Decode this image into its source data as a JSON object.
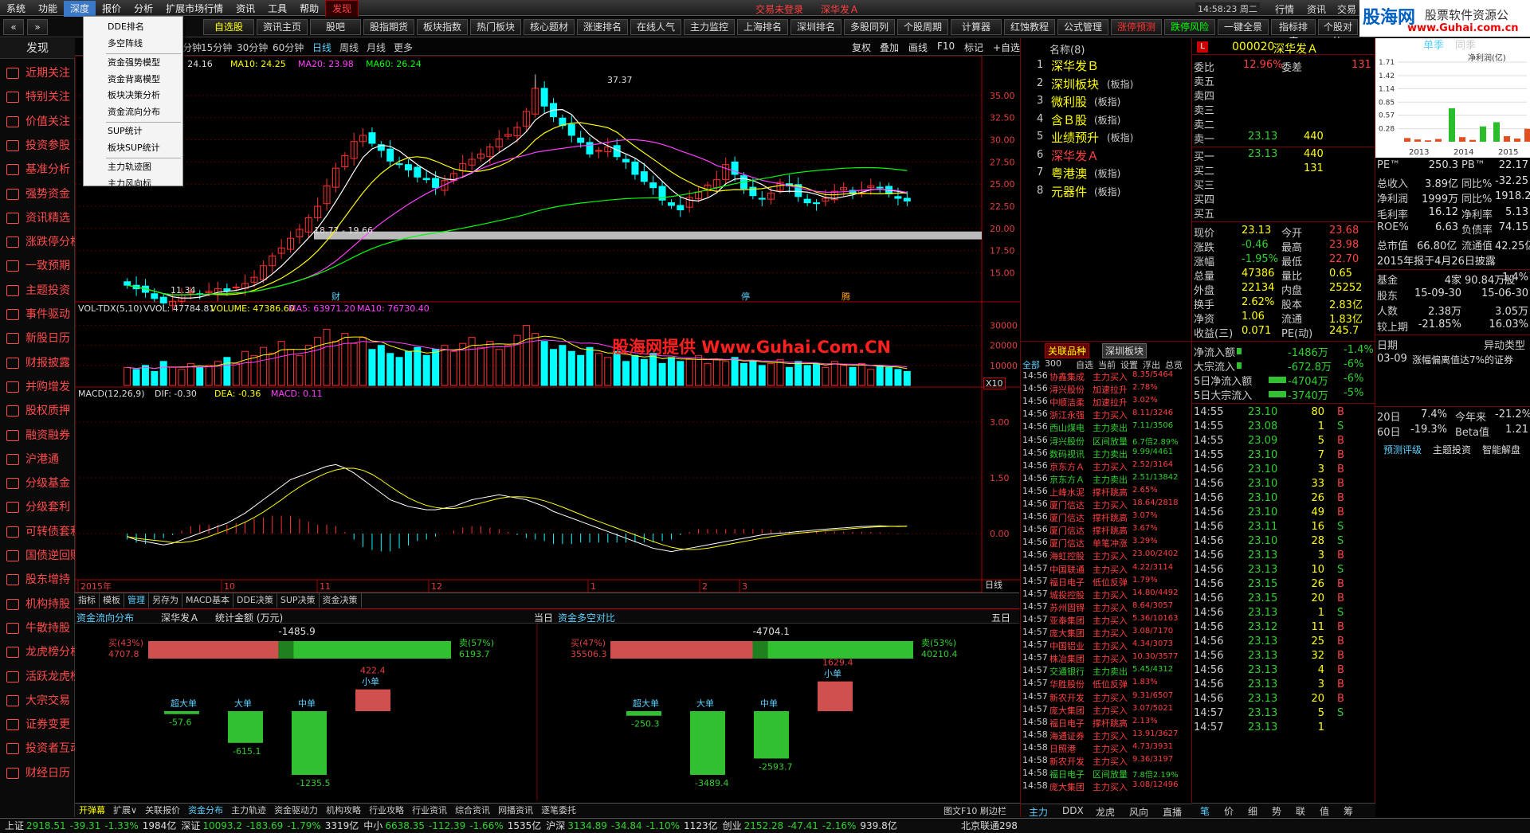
{
  "menu": [
    "系统",
    "功能",
    "深度",
    "报价",
    "分析",
    "扩展市场行情",
    "资讯",
    "工具",
    "帮助",
    "发现"
  ],
  "menu_center": {
    "notice": "交易未登录",
    "stock": "深华发Ａ",
    "time": "14:58:23 周二",
    "right": [
      "行情",
      "资讯",
      "交易"
    ]
  },
  "brand": {
    "name": "股海网",
    "sub": "股票软件资源公",
    "url": "www.Guhai.com.cn"
  },
  "toolbar": [
    "自选股",
    "资讯主页",
    "股吧",
    "股指期货",
    "板块指数",
    "热门板块",
    "核心题材",
    "涨速排名",
    "在线人气",
    "主力监控",
    "上海排名",
    "深圳排名",
    "多股同列",
    "个股周期",
    "计算器",
    "红蚀教程",
    "公式管理",
    "涨停预测",
    "跌停风险",
    "一键全景",
    "指标排序",
    "个股对比"
  ],
  "sidebar": [
    "发现",
    "近期关注",
    "特别关注",
    "价值关注",
    "投资参股",
    "基准分析",
    "强势资金",
    "资讯精选",
    "涨跌停分析",
    "一致预期",
    "主题投资",
    "事件驱动",
    "新股日历",
    "财报披露",
    "并购增发",
    "股权质押",
    "融资融券",
    "沪港通",
    "分级基金",
    "分级套利",
    "可转债套利",
    "国债逆回购",
    "股东增持",
    "机构持股",
    "牛散持股",
    "龙虎榜分析",
    "活跃龙虎榜",
    "大宗交易",
    "证券变更",
    "投资者互动",
    "财经日历"
  ],
  "dropdown": [
    [
      "DDE排名",
      "多空阵线"
    ],
    [
      "资金强势模型",
      "资金背离模型",
      "板块决策分析",
      "资金流向分布"
    ],
    [
      "SUP统计",
      "板块SUP统计"
    ],
    [
      "主力轨迹图",
      "主力风向标"
    ]
  ],
  "period_tabs": [
    "分钟",
    "15分钟",
    "30分钟",
    "60分钟",
    "日线",
    "周线",
    "月线",
    "更多"
  ],
  "chart_tools": [
    "复权",
    "叠加",
    "画线",
    "F10",
    "标记",
    "+自选"
  ],
  "ma_legend": {
    "ma5": "MA5: 24.16",
    "ma10": "MA10: 24.25",
    "ma20": "MA20: 23.98",
    "ma60": "MA60: 26.24"
  },
  "vol_legend": {
    "name": "VOL-TDX(5,10)",
    "vvol": "VVOL: 47784.81",
    "volume": "VOLUME: 47386.60",
    "ma5": "MA5: 63971.20",
    "ma10": "MA10: 76730.40"
  },
  "macd_legend": {
    "name": "MACD(12,26,9)",
    "dif": "DIF: -0.30",
    "dea": "DEA: -0.36",
    "macd": "MACD: 0.11"
  },
  "price_axis": [
    "35.00",
    "32.50",
    "30.00",
    "27.50",
    "25.00",
    "22.50",
    "20.00",
    "17.50",
    "15.00"
  ],
  "vol_axis": [
    "30000",
    "20000",
    "10000"
  ],
  "macd_axis": [
    "3.00",
    "1.50",
    "0.00"
  ],
  "x_axis": [
    "2015年",
    "10",
    "11",
    "12",
    "1",
    "2",
    "3"
  ],
  "chart_labels": {
    "high": "37.37",
    "low": "11.34",
    "band": "18.77 - 19.66",
    "unit": "X10",
    "period": "日线",
    "watermark": "股海网提供 Www.Guhai.Com.CN",
    "events": [
      "财",
      "停",
      "腾"
    ]
  },
  "chart_data": [
    {
      "type": "candlestick",
      "title": "深华发Ａ 日线",
      "yrange": [
        12,
        37.5
      ],
      "events_shown": [
        "high 37.37",
        "low 11.34"
      ],
      "closes": [
        13.6,
        13.2,
        12.8,
        12.1,
        11.6,
        11.8,
        12.5,
        12.8,
        12.6,
        12.9,
        13.2,
        13.0,
        13.4,
        13.8,
        14.5,
        15.8,
        16.9,
        17.8,
        18.9,
        19.9,
        21.2,
        22.5,
        24.8,
        26.8,
        28.2,
        29.8,
        30.5,
        29.6,
        28.8,
        27.6,
        27.2,
        26.6,
        25.8,
        25.5,
        24.6,
        25.4,
        26.2,
        27.3,
        27.8,
        28.4,
        29.2,
        30.1,
        30.6,
        31.4,
        33.2,
        35.8,
        33.8,
        32.6,
        31.6,
        30.5,
        29.7,
        28.4,
        28.8,
        29.2,
        28.1,
        27.5,
        26.1,
        25.3,
        24.6,
        23.2,
        22.6,
        22.1,
        23.5,
        24.1,
        24.9,
        25.5,
        27.2,
        26.1,
        24.5,
        23.7,
        23.3,
        24.0,
        25.2,
        24.8,
        23.6,
        22.9,
        22.8,
        23.4,
        24.2,
        24.6,
        23.9,
        24.3,
        24.8,
        24.6,
        23.9,
        23.4,
        23.1
      ]
    },
    {
      "type": "bar",
      "title": "VOL-TDX(5,10)",
      "yrange": [
        0,
        35000
      ],
      "values": [
        9000,
        8000,
        10000,
        7000,
        12000,
        9000,
        8000,
        11000,
        9000,
        10000,
        12000,
        14000,
        11000,
        17000,
        15000,
        19000,
        16000,
        22000,
        18000,
        15000,
        20000,
        24000,
        28000,
        22000,
        26000,
        21000,
        24000,
        18000,
        20000,
        16000,
        14000,
        17000,
        19000,
        15000,
        18000,
        20000,
        17000,
        21000,
        24000,
        19000,
        22000,
        18000,
        20000,
        25000,
        30000,
        26000,
        22000,
        18000,
        20000,
        17000,
        15000,
        19000,
        16000,
        14000,
        17000,
        12000,
        15000,
        13000,
        16000,
        11000,
        14000,
        12000,
        13000,
        15000,
        11000,
        13000,
        12000,
        14000,
        11000,
        12000,
        10000,
        11000,
        13000,
        9000,
        12000,
        10000,
        11000,
        9000,
        12000,
        10000,
        9000,
        11000,
        8000,
        10000,
        9000,
        8000,
        7000
      ]
    },
    {
      "type": "bar",
      "title": "MACD(12,26,9)",
      "yrange": [
        -1.2,
        3.6
      ],
      "values": [
        -0.2,
        -0.3,
        -0.35,
        -0.4,
        -0.45,
        -0.4,
        -0.3,
        -0.2,
        -0.1,
        0,
        0.1,
        0.2,
        0.35,
        0.5,
        0.7,
        0.9,
        1.1,
        1.3,
        1.5,
        1.6,
        1.7,
        1.8,
        1.9,
        1.95,
        1.85,
        1.7,
        1.5,
        1.3,
        1.1,
        0.9,
        0.8,
        0.7,
        0.65,
        0.6,
        0.6,
        0.65,
        0.7,
        0.8,
        0.9,
        0.95,
        1.0,
        1.05,
        1.0,
        0.95,
        0.9,
        0.8,
        0.7,
        0.55,
        0.45,
        0.35,
        0.25,
        0.15,
        0.05,
        -0.05,
        -0.15,
        -0.25,
        -0.35,
        -0.45,
        -0.55,
        -0.6,
        -0.65,
        -0.6,
        -0.55,
        -0.5,
        -0.45,
        -0.4,
        -0.35,
        -0.3,
        -0.25,
        -0.2,
        -0.15,
        -0.12,
        -0.1,
        -0.08,
        -0.05,
        -0.03,
        0,
        0.02,
        0.04,
        0.06,
        0.08,
        0.1,
        0.11,
        0.12,
        0.11,
        0.1,
        0.11
      ]
    }
  ],
  "flow": {
    "title": "资金流向分布",
    "stock": "深华发Ａ",
    "unit": "统计金额 (万元)",
    "left": {
      "period": "当日",
      "net": "-1485.9",
      "buy_pct": "买(43%)",
      "buy": "4707.8",
      "sell_pct": "卖(57%)",
      "sell": "6193.7",
      "buy_share": 0.43,
      "cats": [
        {
          "name": "超大单",
          "value": "-57.6"
        },
        {
          "name": "大单",
          "value": "-615.1"
        },
        {
          "name": "中单",
          "value": "-1235.5"
        },
        {
          "name": "小单",
          "value": "422.4"
        }
      ]
    },
    "right_title": "资金多空对比",
    "right": {
      "period": "五日",
      "net": "-4704.1",
      "buy_pct": "买(47%)",
      "buy": "35506.3",
      "sell_pct": "卖(53%)",
      "sell": "40210.4",
      "buy_share": 0.47,
      "cats": [
        {
          "name": "超大单",
          "value": "-250.3"
        },
        {
          "name": "大单",
          "value": "-3489.4"
        },
        {
          "name": "中单",
          "value": "-2593.7"
        },
        {
          "name": "小单",
          "value": "1629.4"
        }
      ]
    }
  },
  "bottom_tabs": [
    "指标",
    "模板",
    "管理",
    "另存为",
    "MACD基本",
    "DDE决策",
    "SUP决策",
    "资金决策"
  ],
  "related": {
    "title": "名称(8)",
    "items": [
      [
        "深华发Ｂ",
        ""
      ],
      [
        "深圳板块",
        "(板指)"
      ],
      [
        "微利股",
        "(板指)"
      ],
      [
        "含Ｂ股",
        "(板指)"
      ],
      [
        "业绩预升",
        "(板指)"
      ],
      [
        "深华发Ａ",
        ""
      ],
      [
        "粤港澳",
        "(板指)"
      ],
      [
        "元器件",
        "(板指)"
      ]
    ]
  },
  "flashlist": {
    "tabs": [
      "关联品种",
      "深圳板块"
    ],
    "filters": [
      "全部",
      "300",
      "自选",
      "当前",
      "设置",
      "浮出",
      "总览"
    ],
    "items": [
      [
        "14:56",
        "协鑫集成",
        "主力买入",
        "8.35/5464"
      ],
      [
        "14:56",
        "浔兴股份",
        "加速拉升",
        "2.78%"
      ],
      [
        "14:56",
        "中顺洁柔",
        "加速拉升",
        "3.02%"
      ],
      [
        "14:56",
        "浙江永强",
        "主力买入",
        "8.11/3246"
      ],
      [
        "14:56",
        "西山煤电",
        "主力卖出",
        "7.11/3506"
      ],
      [
        "14:56",
        "浔兴股份",
        "区间放量",
        "6.7倍2.89%"
      ],
      [
        "14:56",
        "数码视讯",
        "主力卖出",
        "9.99/4461"
      ],
      [
        "14:56",
        "京东方Ａ",
        "主力买入",
        "2.52/3164"
      ],
      [
        "14:56",
        "京东方Ａ",
        "主力卖出",
        "2.51/13842"
      ],
      [
        "14:56",
        "上峰水泥",
        "撑杆跳高",
        "2.65%"
      ],
      [
        "14:56",
        "厦门信达",
        "主力买入",
        "18.64/2818"
      ],
      [
        "14:56",
        "厦门信达",
        "撑杆跳高",
        "3.07%"
      ],
      [
        "14:56",
        "厦门信达",
        "撑杆跳高",
        "3.67%"
      ],
      [
        "14:56",
        "厦门信达",
        "单笔冲涨",
        "3.29%"
      ],
      [
        "14:56",
        "海虹控股",
        "主力买入",
        "23.00/2402"
      ],
      [
        "14:57",
        "中国联通",
        "主力买入",
        "4.22/3114"
      ],
      [
        "14:57",
        "福日电子",
        "低位反弹",
        "1.79%"
      ],
      [
        "14:57",
        "城投控股",
        "主力买入",
        "14.80/4492"
      ],
      [
        "14:57",
        "苏州固锝",
        "主力买入",
        "8.64/3057"
      ],
      [
        "14:57",
        "亚泰集团",
        "主力买入",
        "5.36/10163"
      ],
      [
        "14:57",
        "庞大集团",
        "主力买入",
        "3.08/7170"
      ],
      [
        "14:57",
        "中国铝业",
        "主力买入",
        "4.34/3073"
      ],
      [
        "14:57",
        "株冶集团",
        "主力买入",
        "10.30/3577"
      ],
      [
        "14:57",
        "交通银行",
        "主力卖出",
        "5.45/4312"
      ],
      [
        "14:57",
        "华胜股份",
        "低位反弹",
        "1.83%"
      ],
      [
        "14:57",
        "新农开发",
        "主力买入",
        "9.31/6507"
      ],
      [
        "14:57",
        "庞大集团",
        "主力买入",
        "3.07/5021"
      ],
      [
        "14:58",
        "福日电子",
        "撑杆跳高",
        "2.13%"
      ],
      [
        "14:58",
        "海通证券",
        "主力买入",
        "13.91/3627"
      ],
      [
        "14:58",
        "日照港",
        "主力买入",
        "4.73/3931"
      ],
      [
        "14:58",
        "新农开发",
        "主力买入",
        "9.36/3197"
      ],
      [
        "14:58",
        "福日电子",
        "区间放量",
        "7.8倍2.19%"
      ],
      [
        "14:58",
        "庞大集团",
        "主力买入",
        "3.08/12496"
      ]
    ],
    "bottom_tabs": [
      "主力",
      "DDX",
      "龙虎",
      "风向",
      "直播"
    ]
  },
  "quote": {
    "code": "000020",
    "name": "深华发Ａ",
    "weibi": "12.96%",
    "weicha": "131",
    "asks": [
      "卖五",
      "卖四",
      "卖三",
      "卖二",
      "卖一"
    ],
    "ask1": [
      "23.13",
      "440"
    ],
    "bids": [
      [
        "买一",
        "23.13",
        "440"
      ],
      [
        "买二",
        "",
        "131"
      ],
      [
        "买三",
        "",
        ""
      ],
      [
        "买四",
        "",
        ""
      ],
      [
        "买五",
        "",
        ""
      ]
    ],
    "stats": [
      [
        "现价",
        "23.13",
        "今开",
        "23.68"
      ],
      [
        "涨跌",
        "-0.46",
        "最高",
        "23.98"
      ],
      [
        "涨幅",
        "-1.95%",
        "最低",
        "22.70"
      ],
      [
        "总量",
        "47386",
        "量比",
        "0.65"
      ],
      [
        "外盘",
        "22134",
        "内盘",
        "25252"
      ],
      [
        "换手",
        "2.62%",
        "股本",
        "2.83亿"
      ],
      [
        "净资",
        "1.06",
        "流通",
        "1.83亿"
      ],
      [
        "收益(三)",
        "0.071",
        "PE(动)",
        "245.7"
      ]
    ],
    "flows": [
      [
        "净流入额",
        "-1486万",
        "-1.4%"
      ],
      [
        "大宗流入",
        "-672.8万",
        "-6%"
      ],
      [
        "5日净流入额",
        "-4704万",
        "-6%"
      ],
      [
        "5日大宗流入",
        "-3740万",
        "-5%"
      ]
    ],
    "ticks": [
      [
        "14:55",
        "23.10",
        "80",
        "B"
      ],
      [
        "14:55",
        "23.08",
        "1",
        "S"
      ],
      [
        "14:55",
        "23.09",
        "5",
        "B"
      ],
      [
        "14:55",
        "23.10",
        "7",
        "B"
      ],
      [
        "14:56",
        "23.10",
        "3",
        "B"
      ],
      [
        "14:56",
        "23.10",
        "33",
        "B"
      ],
      [
        "14:56",
        "23.10",
        "26",
        "B"
      ],
      [
        "14:56",
        "23.10",
        "49",
        "B"
      ],
      [
        "14:56",
        "23.11",
        "16",
        "S"
      ],
      [
        "14:56",
        "23.10",
        "28",
        "S"
      ],
      [
        "14:56",
        "23.13",
        "3",
        "B"
      ],
      [
        "14:56",
        "23.13",
        "10",
        "S"
      ],
      [
        "14:56",
        "23.15",
        "26",
        "B"
      ],
      [
        "14:56",
        "23.15",
        "20",
        "B"
      ],
      [
        "14:56",
        "23.13",
        "1",
        "S"
      ],
      [
        "14:56",
        "23.12",
        "11",
        "B"
      ],
      [
        "14:56",
        "23.13",
        "25",
        "B"
      ],
      [
        "14:56",
        "23.13",
        "32",
        "B"
      ],
      [
        "14:56",
        "23.13",
        "4",
        "B"
      ],
      [
        "14:56",
        "23.13",
        "3",
        "B"
      ],
      [
        "14:56",
        "23.13",
        "20",
        "B"
      ],
      [
        "14:57",
        "23.13",
        "5",
        "S"
      ],
      [
        "14:57",
        "23.13",
        "1",
        ""
      ]
    ],
    "bottom_tabs": [
      "笔",
      "价",
      "细",
      "势",
      "联",
      "值",
      "筹"
    ]
  },
  "f10": {
    "tabs": [
      "单季",
      "同季"
    ],
    "bar_title": "净利润(亿)",
    "bar_years": [
      "2013",
      "2014",
      "2015"
    ],
    "bar_axis": [
      "1.71",
      "1.42",
      "1.14",
      "0.85",
      "0.57",
      "0.28"
    ],
    "bar_values": [
      0.08,
      0.05,
      0.03,
      0.06,
      0.72,
      0.1,
      0.04,
      0.33,
      0.42,
      0.12,
      0.07,
      0.28
    ],
    "rows": [
      [
        "PE™",
        "250.3",
        "PB™",
        "22.17"
      ],
      [
        "总收入",
        "3.89亿",
        "同比%",
        "-32.25"
      ],
      [
        "净利润",
        "1999万",
        "同比%",
        "1918.23"
      ],
      [
        "毛利率",
        "16.12",
        "净利率",
        "5.13"
      ],
      [
        "ROE%",
        "6.63",
        "负债率",
        "74.15"
      ],
      [
        "总市值",
        "66.80亿",
        "流通值",
        "42.25亿"
      ]
    ],
    "report": "2015年报于4月26日披露",
    "holders": [
      [
        "基金",
        "4家",
        "90.84万股",
        "1.4%"
      ],
      [
        "股东",
        "15-09-30",
        "",
        "15-06-30"
      ],
      [
        "人数",
        "2.38万",
        "",
        "3.05万"
      ],
      [
        "较上期",
        "-21.85%",
        "",
        "16.03%"
      ]
    ],
    "event": [
      [
        "日期",
        "",
        "",
        "异动类型"
      ],
      [
        "03-09",
        "涨幅偏离值达7%的证券",
        "",
        ""
      ]
    ],
    "perf": [
      [
        "20日",
        "7.4%",
        "今年来",
        "-21.2%"
      ],
      [
        "60日",
        "-19.3%",
        "Beta值",
        "1.21"
      ]
    ],
    "links": [
      "预测评级",
      "主题投资",
      "智能解盘"
    ]
  },
  "statusbar": [
    {
      "name": "上证",
      "val": "2918.51",
      "chg": "-39.31",
      "pct": "-1.33%",
      "amt": "1984亿"
    },
    {
      "name": "深证",
      "val": "10093.2",
      "chg": "-183.69",
      "pct": "-1.79%",
      "amt": "3319亿"
    },
    {
      "name": "中小",
      "val": "6638.35",
      "chg": "-112.39",
      "pct": "-1.66%",
      "amt": "1535亿"
    },
    {
      "name": "沪深",
      "val": "3134.89",
      "chg": "-34.84",
      "pct": "-1.10%",
      "amt": "1123亿"
    },
    {
      "name": "创业",
      "val": "2152.28",
      "chg": "-47.41",
      "pct": "-2.16%",
      "amt": "939.8亿"
    }
  ],
  "statusbar_right": "北京联通298",
  "panel_tabs": [
    "开弹幕",
    "扩展∨",
    "关联报价",
    "资金分布",
    "主力轨迹",
    "资金驱动力",
    "机构攻略",
    "行业攻略",
    "行业资讯",
    "综合资讯",
    "网播资讯",
    "逐笔委托"
  ],
  "panel_right": "图文F10 刷边栏"
}
